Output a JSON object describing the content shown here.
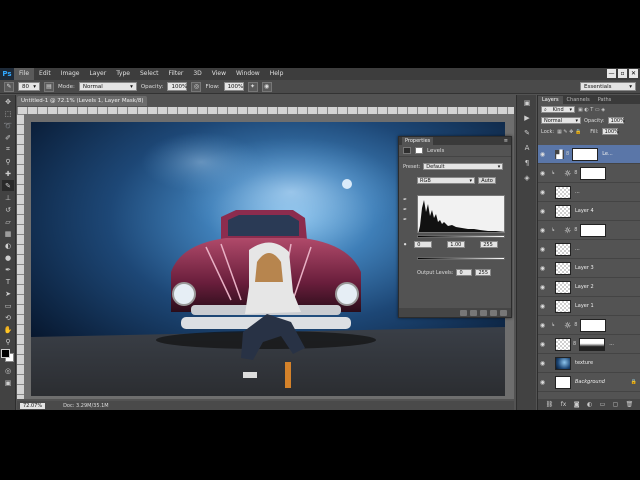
{
  "menubar": {
    "logo": "Ps",
    "items": [
      "File",
      "Edit",
      "Image",
      "Layer",
      "Type",
      "Select",
      "Filter",
      "3D",
      "View",
      "Window",
      "Help"
    ],
    "window_controls": [
      "—",
      "▫",
      "✕"
    ]
  },
  "options": {
    "mode_label": "Mode:",
    "mode_value": "Normal",
    "opacity_label": "Opacity:",
    "opacity_value": "100%",
    "flow_label": "Flow:",
    "flow_value": "100%",
    "brush_size": "80",
    "workspace": "Essentials"
  },
  "document": {
    "tab_title": "Untitled-1 @ 72.1% (Levels 1, Layer Mask/8) *",
    "zoom": "72.07%",
    "doc_info": "Doc: 3.29M/35.1M"
  },
  "properties": {
    "tab": "Properties",
    "title": "Levels",
    "preset_label": "Preset:",
    "preset_value": "Default",
    "channel_value": "RGB",
    "auto_label": "Auto",
    "input_black": "0",
    "input_gamma": "1.00",
    "input_white": "255",
    "output_label": "Output Levels:",
    "output_black": "0",
    "output_white": "255"
  },
  "layers_panel": {
    "tabs": [
      "Layers",
      "Channels",
      "Paths"
    ],
    "kind_label": "Kind",
    "blend_mode": "Normal",
    "opacity_label": "Opacity:",
    "opacity_value": "100%",
    "lock_label": "Lock:",
    "fill_label": "Fill:",
    "fill_value": "100%",
    "layers": [
      {
        "name": "Le...",
        "type": "adjust-mask",
        "selected": true
      },
      {
        "name": "",
        "type": "clip-adjust-mask",
        "selected": false
      },
      {
        "name": "...",
        "type": "pixel",
        "selected": false
      },
      {
        "name": "Layer 4",
        "type": "pixel",
        "selected": false
      },
      {
        "name": "",
        "type": "adjust-white",
        "selected": false
      },
      {
        "name": "...",
        "type": "pixel",
        "selected": false
      },
      {
        "name": "Layer 3",
        "type": "pixel",
        "selected": false
      },
      {
        "name": "Layer 2",
        "type": "pixel",
        "selected": false
      },
      {
        "name": "Layer 1",
        "type": "pixel",
        "selected": false
      },
      {
        "name": "",
        "type": "clip-adjust-white",
        "selected": false
      },
      {
        "name": "...",
        "type": "pixel-mask",
        "selected": false
      },
      {
        "name": "texture",
        "type": "texture",
        "selected": false
      },
      {
        "name": "Background",
        "type": "background",
        "selected": false
      }
    ]
  },
  "colors": {
    "accent": "#31a8ff",
    "selected_layer": "#5a76a8",
    "panel_bg": "#535353"
  }
}
